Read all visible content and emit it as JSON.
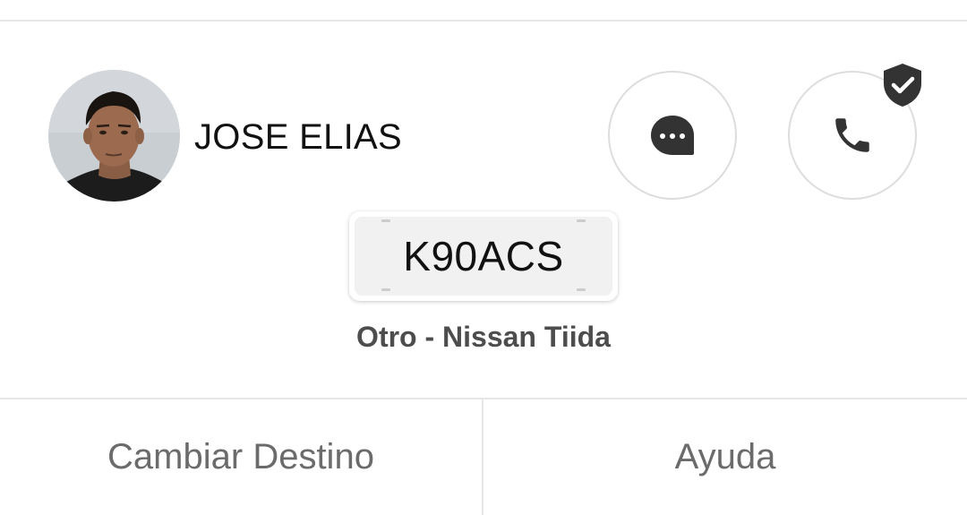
{
  "driver": {
    "name": "JOSE ELIAS",
    "avatar_alt": "driver photo"
  },
  "actions": {
    "chat_icon": "chat-bubble-icon",
    "call_icon": "phone-icon",
    "verified_icon": "shield-check-icon"
  },
  "vehicle": {
    "plate": "K90ACS",
    "description": "Otro - Nissan Tiida"
  },
  "footer": {
    "change_destination_label": "Cambiar Destino",
    "help_label": "Ayuda"
  },
  "colors": {
    "text_primary": "#111111",
    "text_secondary": "#4d4d4d",
    "button_text": "#6b6b6b",
    "icon": "#333333",
    "divider": "#e6e6e6",
    "plate_bg": "#f1f1f1"
  }
}
